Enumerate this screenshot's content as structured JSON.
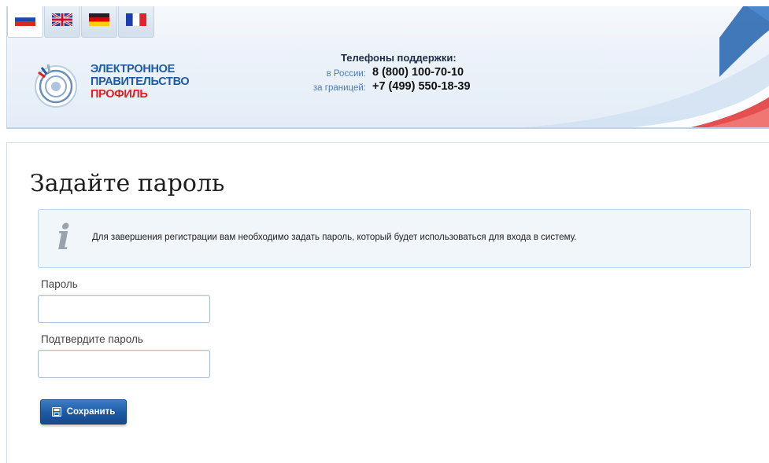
{
  "languages": [
    {
      "code": "ru",
      "icon": "flag-ru-icon",
      "active": true
    },
    {
      "code": "en",
      "icon": "flag-gb-icon",
      "active": false
    },
    {
      "code": "de",
      "icon": "flag-de-icon",
      "active": false
    },
    {
      "code": "fr",
      "icon": "flag-fr-icon",
      "active": false
    }
  ],
  "logo": {
    "line1": "ЭЛЕКТРОННОЕ",
    "line2": "ПРАВИТЕЛЬСТВО",
    "line3": "ПРОФИЛЬ",
    "icon": "gosuslugi-emblem-icon"
  },
  "support": {
    "title": "Телефоны поддержки:",
    "russia_label": "в России:",
    "russia_number": "8 (800) 100-70-10",
    "abroad_label": "за границей:",
    "abroad_number": "+7 (499) 550-18-39"
  },
  "page": {
    "title": "Задайте пароль",
    "info_icon": "info-icon",
    "info_text": "Для завершения регистрации вам необходимо задать пароль, который будет использоваться для входа в систему."
  },
  "form": {
    "password_label": "Пароль",
    "password_value": "",
    "confirm_label": "Подтвердите пароль",
    "confirm_value": "",
    "save_label": "Сохранить",
    "save_icon": "save-icon"
  },
  "colors": {
    "brand_blue": "#1f5aa6",
    "brand_red": "#e02020",
    "button_blue": "#1d59a3",
    "info_border": "#bcd5ec"
  }
}
